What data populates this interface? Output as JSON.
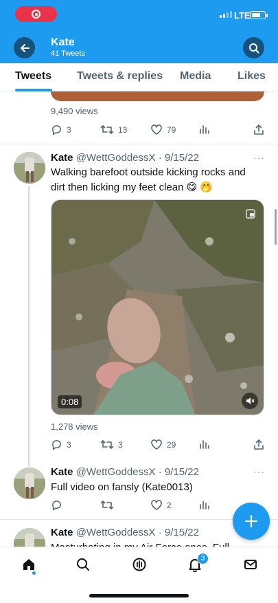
{
  "status_bar": {
    "network": "LTE",
    "battery_level": 0.7,
    "signal_bars": 2,
    "icons": [
      "screen-record-icon",
      "signal-icon",
      "battery-icon"
    ]
  },
  "header": {
    "title": "Kate",
    "subtitle": "41 Tweets",
    "icons": [
      "back-arrow-icon",
      "search-icon"
    ]
  },
  "tabs": [
    {
      "label": "Tweets",
      "active": true
    },
    {
      "label": "Tweets & replies",
      "active": false
    },
    {
      "label": "Media",
      "active": false
    },
    {
      "label": "Likes",
      "active": false
    }
  ],
  "previous_tweet": {
    "views": "9,490 views",
    "replies": "3",
    "retweets": "13",
    "likes": "79"
  },
  "tweets": [
    {
      "name": "Kate",
      "handle": "@WettGoddessX",
      "dot": "·",
      "date": "9/15/22",
      "text": "Walking barefoot outside kicking rocks and dirt then licking my feet clean 😋 🤭",
      "video_duration": "0:08",
      "views": "1,278 views",
      "replies": "3",
      "retweets": "3",
      "likes": "29"
    },
    {
      "name": "Kate",
      "handle": "@WettGoddessX",
      "dot": "·",
      "date": "9/15/22",
      "text": "Full video on fansly (Kate0013)",
      "replies": "",
      "retweets": "",
      "likes": "2"
    },
    {
      "name": "Kate",
      "handle": "@WettGoddessX",
      "dot": "·",
      "date": "9/15/22",
      "text": "Masturbating in my Air Force ones. Full"
    }
  ],
  "more_label": "···",
  "fab_icon": "compose-plus-icon",
  "bottom_nav": {
    "items": [
      "home-icon",
      "search-icon",
      "spaces-icon",
      "notifications-icon",
      "messages-icon"
    ],
    "notification_count": "3"
  },
  "colors": {
    "accent": "#1d9bf0",
    "header_button": "#15527e",
    "record": "#e8334a",
    "text_primary": "#0f1419",
    "text_secondary": "#536471"
  }
}
